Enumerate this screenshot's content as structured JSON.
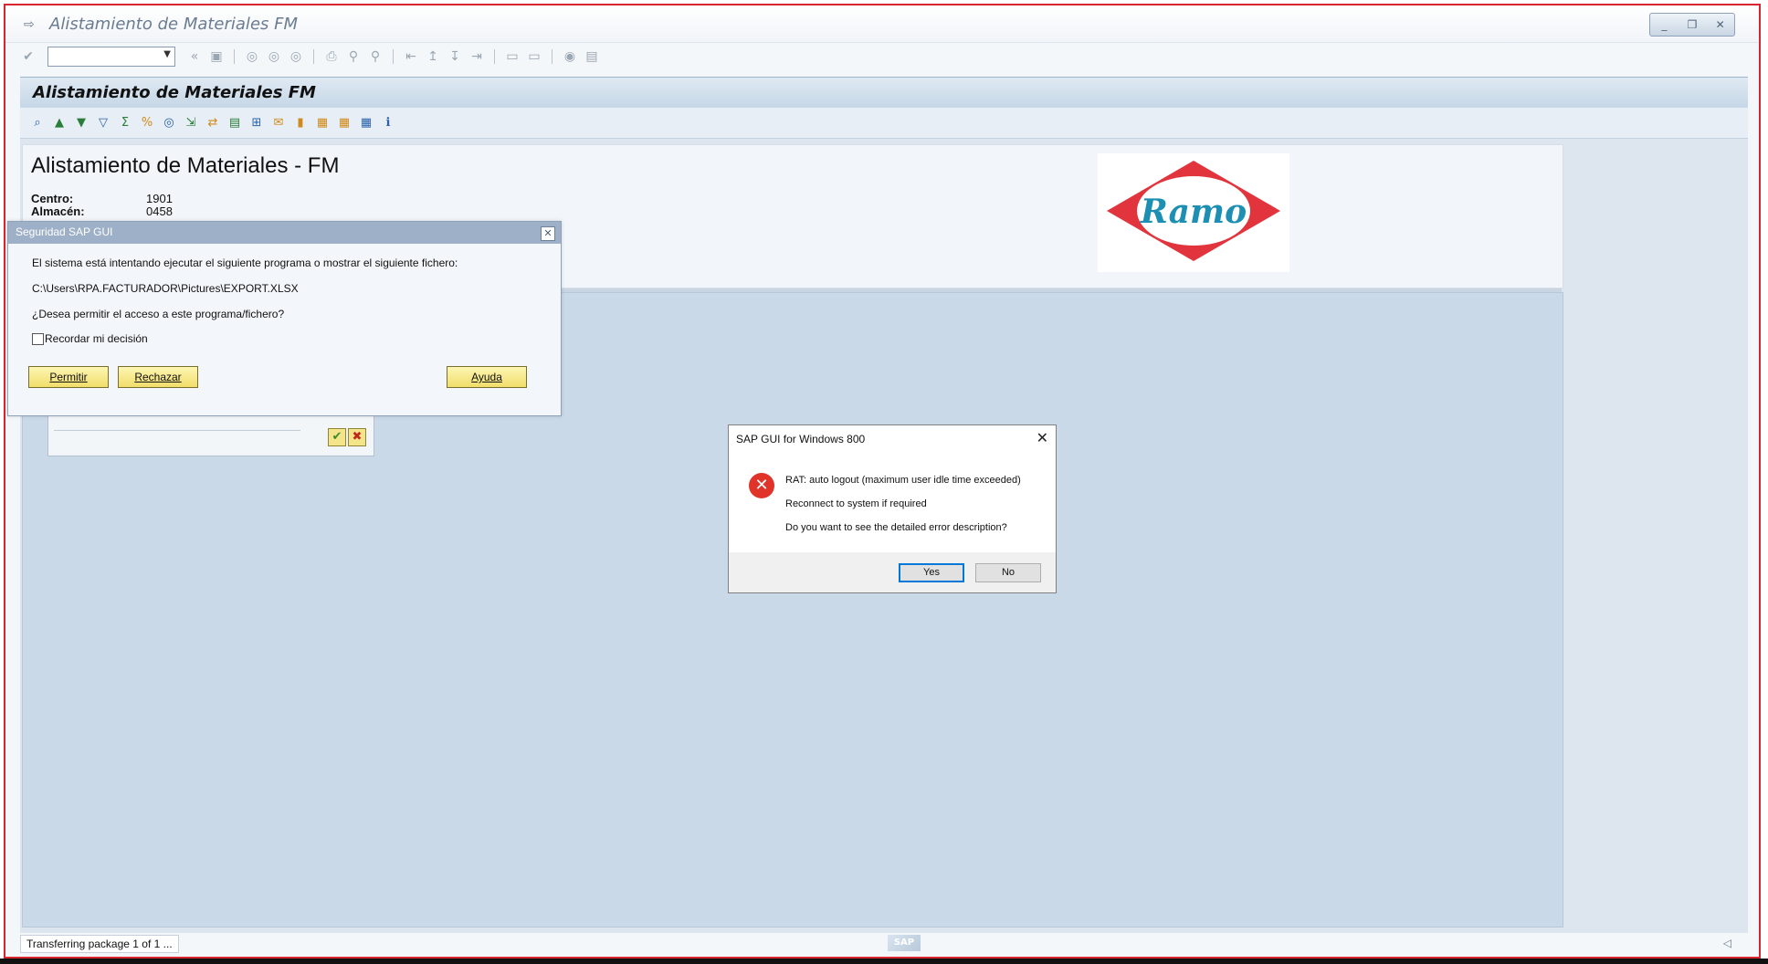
{
  "window": {
    "title": "Alistamiento de Materiales FM",
    "controls": [
      "_",
      "❐",
      "✕"
    ]
  },
  "app": {
    "header": "Alistamiento de Materiales FM"
  },
  "report": {
    "title": "Alistamiento de Materiales - FM",
    "fields": [
      {
        "label": "Centro:",
        "value": "1901"
      },
      {
        "label": "Almacén:",
        "value": "0458"
      }
    ],
    "logo_text": "Ramo"
  },
  "security_dialog": {
    "title": "Seguridad SAP GUI",
    "message": "El sistema está intentando ejecutar el siguiente programa o mostrar el siguiente fichero:",
    "path": "C:\\Users\\RPA.FACTURADOR\\Pictures\\EXPORT.XLSX",
    "question": "¿Desea permitir el acceso a este programa/fichero?",
    "remember_label": "Recordar mi decisión",
    "buttons": {
      "allow": "Permitir",
      "reject": "Rechazar",
      "help": "Ayuda"
    }
  },
  "error_dialog": {
    "title": "SAP GUI for Windows 800",
    "lines": [
      "RAT: auto logout (maximum user idle time exceeded)",
      "Reconnect to system if required",
      "Do you want to see the detailed error description?"
    ],
    "buttons": {
      "yes": "Yes",
      "no": "No"
    }
  },
  "status": {
    "text": "Transferring package 1  of 1",
    "more": "...",
    "brand": "SAP"
  }
}
